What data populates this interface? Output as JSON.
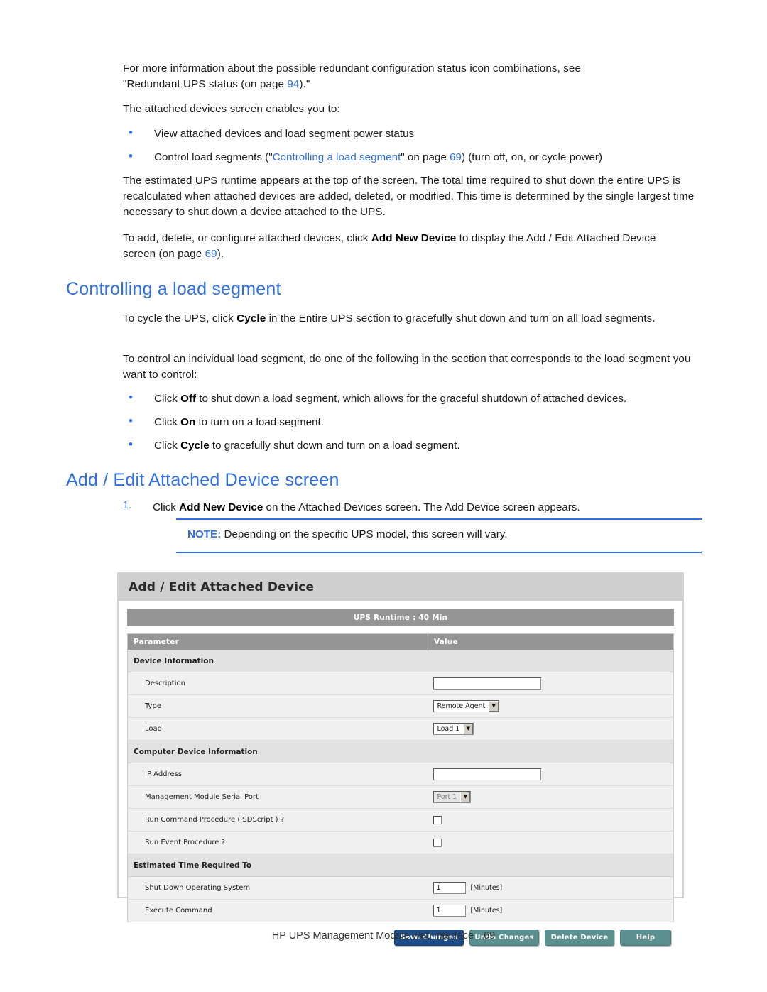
{
  "document": {
    "paragraphs": {
      "p1_a": "For more information about the possible redundant configuration status icon combinations, see",
      "p1_b": "\"Redundant UPS status (on page ",
      "p1_page": "94",
      "p1_c": ").\"",
      "p2": "The attached devices screen enables you to:",
      "p3_a": "The estimated UPS runtime appears at the top of the screen. The total time required to shut down the entire UPS is recalculated when attached devices are added, deleted, or modified. This time is determined by the single largest time necessary to shut down a device attached to the UPS.",
      "p4_a": "To add, delete, or configure attached devices, click ",
      "p4_bold": "Add New Device",
      "p4_b": " to display the Add / Edit Attached Device screen (on page ",
      "p4_page": "69",
      "p4_c": ").",
      "p5_a": "To cycle the UPS, click ",
      "p5_bold": "Cycle",
      "p5_b": " in the Entire UPS section to gracefully shut down and turn on all load segments.",
      "p6": "To control an individual load segment, do one of the following in the section that corresponds to the load segment you want to control:"
    },
    "bullets_1": [
      {
        "marker": "•",
        "pre": "View attached devices and load segment power status",
        "link": "",
        "post": ""
      },
      {
        "marker": "•",
        "pre": "Control load segments (\"",
        "link": "Controlling a load segment",
        "mid": "\" on page ",
        "page": "69",
        "post": ") (turn off, on, or cycle power)"
      }
    ],
    "bullets_2": [
      {
        "marker": "•",
        "pre": "Click ",
        "bold": "Off",
        "post": " to shut down a load segment, which allows for the graceful shutdown of attached devices."
      },
      {
        "marker": "•",
        "pre": "Click ",
        "bold": "On",
        "post": " to turn on a load segment."
      },
      {
        "marker": "•",
        "pre": "Click ",
        "bold": "Cycle",
        "post": " to gracefully shut down and turn on a load segment."
      }
    ],
    "headings": {
      "h1": "Controlling a load segment",
      "h2": "Add / Edit Attached Device screen"
    },
    "steps": [
      {
        "marker": "1.",
        "pre": "Click ",
        "bold": "Add New Device",
        "post": " on the Attached Devices screen. The Add Device screen appears."
      }
    ],
    "note": {
      "label": "NOTE:",
      "text": " Depending on the specific UPS model, this screen will vary."
    },
    "footer": {
      "text": "HP UPS Management Module web interface",
      "page": "69"
    },
    "colors": {
      "heading_blue": "#2f6fe4",
      "link_blue": "#2f6fe4",
      "note_rule": "#2f6fe4"
    }
  },
  "screenshot": {
    "title": "Add / Edit Attached Device",
    "runtime_bar": "UPS Runtime : 40 Min",
    "columns": [
      "Parameter",
      "Value"
    ],
    "rows": [
      {
        "kind": "group",
        "label": "Device Information"
      },
      {
        "kind": "field",
        "label": "Description",
        "control": "text",
        "value": ""
      },
      {
        "kind": "field",
        "label": "Type",
        "control": "select",
        "value": "Remote Agent"
      },
      {
        "kind": "field",
        "label": "Load",
        "control": "select",
        "value": "Load 1"
      },
      {
        "kind": "group",
        "label": "Computer Device Information"
      },
      {
        "kind": "field",
        "label": "IP Address",
        "control": "text",
        "value": ""
      },
      {
        "kind": "field",
        "label": "Management Module Serial Port",
        "control": "select-disabled",
        "value": "Port 1"
      },
      {
        "kind": "field",
        "label": "Run Command Procedure ( SDScript ) ?",
        "control": "checkbox",
        "value": ""
      },
      {
        "kind": "field",
        "label": "Run Event Procedure ?",
        "control": "checkbox",
        "value": ""
      },
      {
        "kind": "group",
        "label": "Estimated Time Required To"
      },
      {
        "kind": "field",
        "label": "Shut Down Operating System",
        "control": "number",
        "value": "1",
        "unit": "[Minutes]"
      },
      {
        "kind": "field",
        "label": "Execute Command",
        "control": "number",
        "value": "1",
        "unit": "[Minutes]"
      }
    ],
    "buttons": [
      {
        "label": "Save Changes",
        "style": "primary"
      },
      {
        "label": "Undo Changes",
        "style": "secondary"
      },
      {
        "label": "Delete Device",
        "style": "secondary"
      },
      {
        "label": "Help",
        "style": "secondary-small"
      }
    ],
    "colors": {
      "header_gray": "#959595",
      "title_gray": "#cfcfcf",
      "primary_button": "#1d4e8a",
      "secondary_button": "#5a9190"
    }
  }
}
